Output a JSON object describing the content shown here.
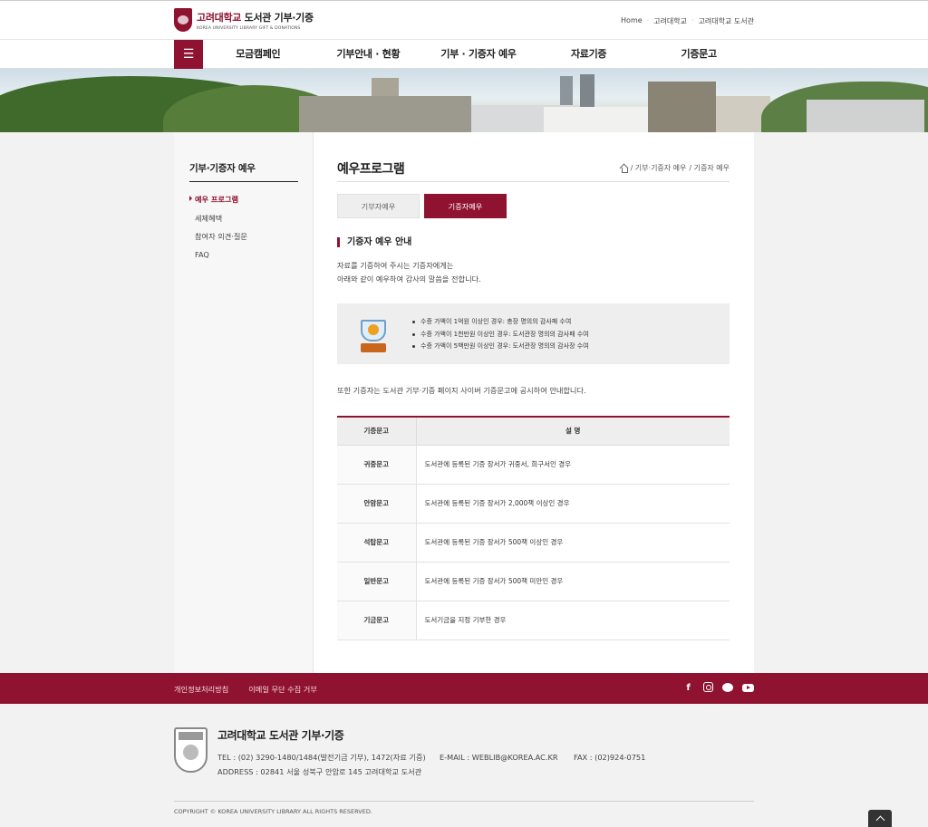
{
  "header": {
    "logo_main_red": "고려대학교",
    "logo_main": "도서관 기부·기증",
    "logo_sub": "KOREA UNIVERSITY LIBRARY GIFT & DONATIONS",
    "util_links": [
      "Home",
      "고려대학교",
      "고려대학교 도서관"
    ]
  },
  "nav": {
    "menu_icon": "hamburger-icon",
    "items": [
      "모금캠페인",
      "기부안내 · 현황",
      "기부 · 기증자 예우",
      "자료기증",
      "기증문고"
    ]
  },
  "lnb": {
    "title": "기부·기증자 예우",
    "items": [
      "예우 프로그램",
      "세제혜택",
      "참여자 의견·질문",
      "FAQ"
    ],
    "active_index": 0
  },
  "main": {
    "page_title": "예우프로그램",
    "breadcrumb": [
      "/ 기부·기증자 예우",
      "/ 기증자 예우"
    ],
    "tabs": [
      "기부자예우",
      "기증자예우"
    ],
    "active_tab": 1,
    "section_title": "기증자 예우 안내",
    "intro": [
      "자료를 기증하여 주시는 기증자에게는",
      "아래와 같이 예우하여 감사의 말씀을 전합니다."
    ],
    "benefits": [
      "수증 가액이 1억원 이상인 경우: 총장 명의의 감사패 수여",
      "수증 가액이 1천만원 이상인 경우: 도서관장 명의의 감사패 수여",
      "수증 가액이 5백만원 이상인 경우: 도서관장 명의의 감사장 수여"
    ],
    "notice": "또한 기증자는 도서관 기부·기증 페이지 사이버 기증문고에 공시하여 안내합니다.",
    "table": {
      "headers": [
        "기증문고",
        "설 명"
      ],
      "rows": [
        [
          "귀중문고",
          "도서관에 등록된 기증 장서가 귀중서, 희구서인 경우"
        ],
        [
          "안암문고",
          "도서관에 등록된 기증 장서가 2,000책 이상인 경우"
        ],
        [
          "석탑문고",
          "도서관에 등록된 기증 장서가 500책 이상인 경우"
        ],
        [
          "일반문고",
          "도서관에 등록된 기증 장서가 500책 미만인 경우"
        ],
        [
          "기금문고",
          "도서기금을 지정 기부한 경우"
        ]
      ]
    }
  },
  "footer": {
    "links": [
      "개인정보처리방침",
      "이메일 무단 수집 거부"
    ],
    "name": "고려대학교 도서관 기부·기증",
    "tel": "TEL : (02) 3290-1480/1484(발전기금 기부), 1472(자료 기증)",
    "email": "E-MAIL : WEBLIB@KOREA.AC.KR",
    "fax": "FAX : (02)924-0751",
    "address": "ADDRESS : 02841 서울 성북구 안암로 145 고려대학교 도서관",
    "copyright": "COPYRIGHT © KOREA UNIVERSITY LIBRARY ALL RIGHTS RESERVED."
  },
  "colors": {
    "brand": "#8f1230"
  }
}
